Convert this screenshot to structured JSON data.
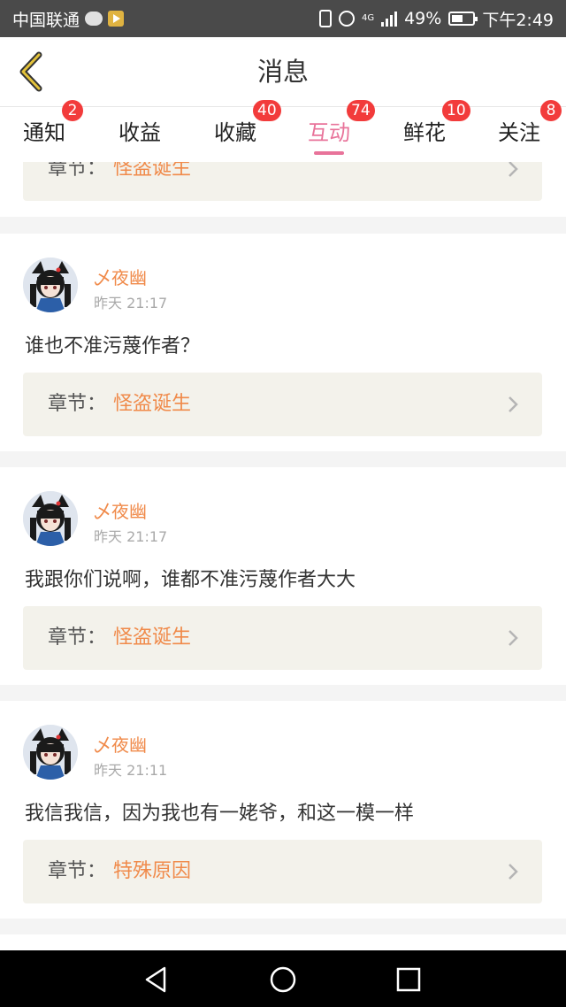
{
  "status_bar": {
    "carrier": "中国联通",
    "network": "4G",
    "battery": "49%",
    "time": "下午2:49",
    "icons": [
      "wechat-icon",
      "app-icon",
      "vibrate-icon",
      "alarm-icon",
      "signal-icon",
      "battery-icon"
    ]
  },
  "header": {
    "title": "消息",
    "back_icon": "chevron-left-icon"
  },
  "tabs": [
    {
      "label": "通知",
      "badge": "2",
      "active": false
    },
    {
      "label": "收益",
      "badge": "",
      "active": false
    },
    {
      "label": "收藏",
      "badge": "40",
      "active": false
    },
    {
      "label": "互动",
      "badge": "74",
      "active": true
    },
    {
      "label": "鲜花",
      "badge": "10",
      "active": false
    },
    {
      "label": "关注",
      "badge": "8",
      "active": false
    }
  ],
  "colors": {
    "accent": "#e8739a",
    "name": "#f08a4a",
    "badge": "#f23b3b"
  },
  "chapter_label": "章节：",
  "partial_card": {
    "chapter_title": "怪盗诞生"
  },
  "messages": [
    {
      "user": "乄夜幽",
      "time": "昨天 21:17",
      "text": "谁也不准污蔑作者？",
      "chapter_title": "怪盗诞生"
    },
    {
      "user": "乄夜幽",
      "time": "昨天 21:17",
      "text": "我跟你们说啊，谁都不准污蔑作者大大",
      "chapter_title": "怪盗诞生"
    },
    {
      "user": "乄夜幽",
      "time": "昨天 21:11",
      "text": "我信我信，因为我也有一姥爷，和这一模一样",
      "chapter_title": "特殊原因"
    }
  ],
  "nav": [
    "back-icon",
    "home-icon",
    "recents-icon"
  ]
}
